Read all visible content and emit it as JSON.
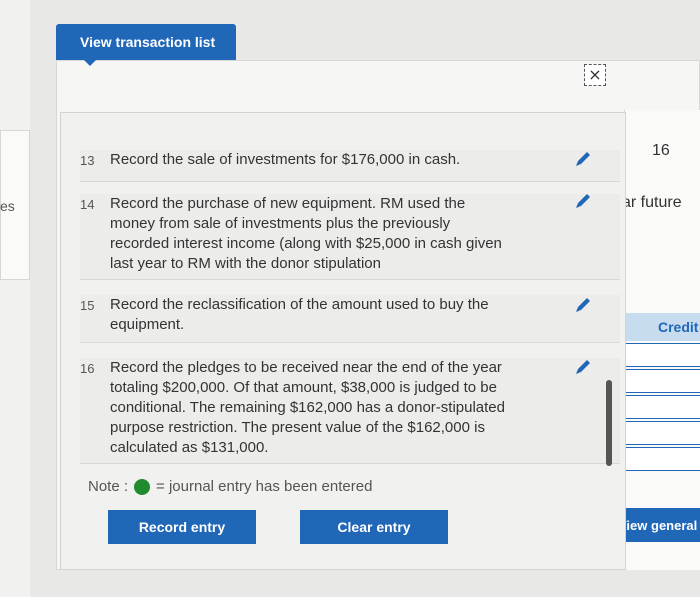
{
  "tab": {
    "label": "View transaction list"
  },
  "background": {
    "left_label": "es",
    "right_number": "16",
    "right_fragment": "ar future",
    "credit_header": "Credit",
    "view_general_label": "View general"
  },
  "close_icon": "×",
  "transactions": [
    {
      "num": "13",
      "text": "Record the sale of investments for $176,000 in cash."
    },
    {
      "num": "14",
      "text": "Record the purchase of new equipment. RM used the money from sale of investments plus the previously recorded interest income (along with $25,000 in cash given last year to RM with the donor stipulation"
    },
    {
      "num": "15",
      "text": "Record the reclassification of the amount used to buy the equipment."
    },
    {
      "num": "16",
      "text": "Record the pledges to be received near the end of the year totaling $200,000. Of that amount, $38,000 is judged to be conditional. The remaining $162,000 has a donor-stipulated purpose restriction. The present value of the $162,000 is calculated as $131,000."
    }
  ],
  "note": {
    "label": "Note :",
    "text": "= journal entry has been entered"
  },
  "buttons": {
    "record": "Record entry",
    "clear": "Clear entry"
  },
  "colors": {
    "accent": "#2067b8",
    "entered_dot": "#1f8a2e"
  }
}
